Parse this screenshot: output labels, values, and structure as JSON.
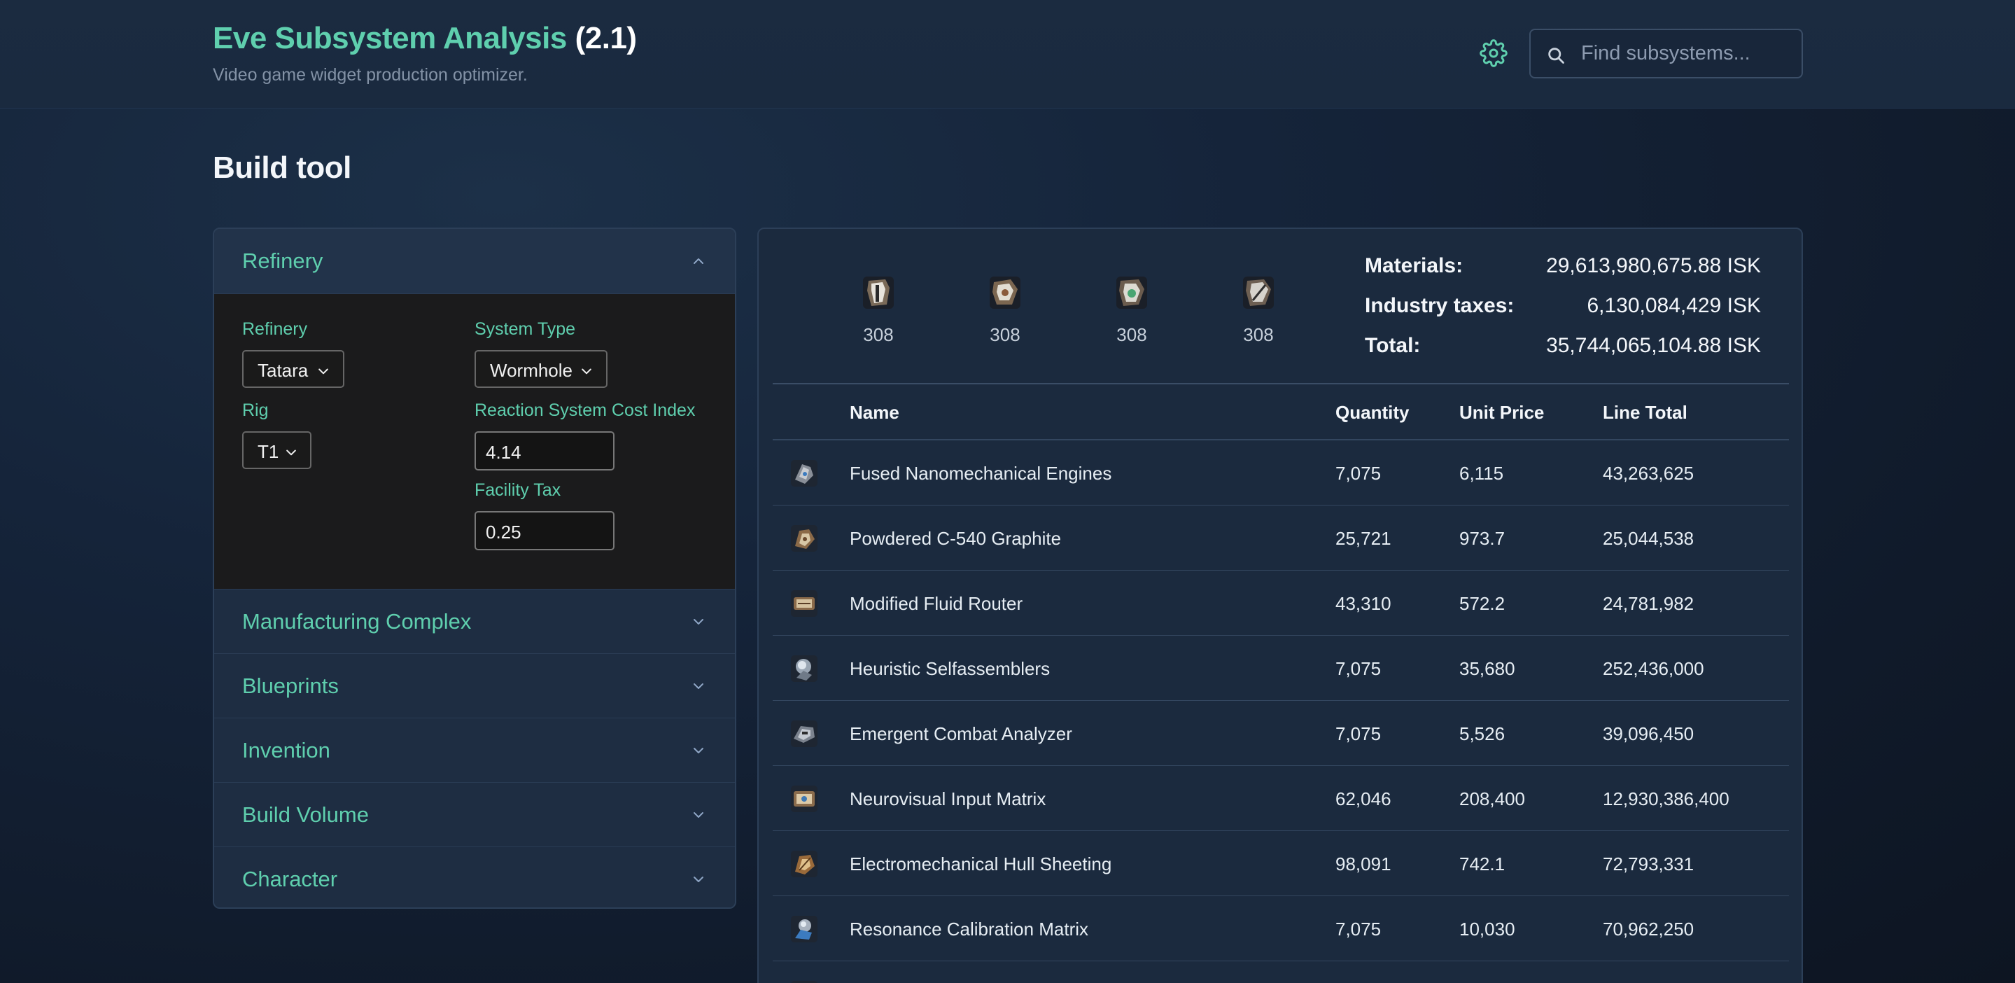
{
  "header": {
    "app_name": "Eve Subsystem Analysis",
    "version": "(2.1)",
    "subtitle": "Video game widget production optimizer.",
    "search_placeholder": "Find subsystems..."
  },
  "page": {
    "title": "Build tool"
  },
  "accordion": {
    "sections": [
      {
        "label": "Refinery",
        "open": true
      },
      {
        "label": "Manufacturing Complex",
        "open": false
      },
      {
        "label": "Blueprints",
        "open": false
      },
      {
        "label": "Invention",
        "open": false
      },
      {
        "label": "Build Volume",
        "open": false
      },
      {
        "label": "Character",
        "open": false
      }
    ],
    "refinery": {
      "refinery_label": "Refinery",
      "refinery_value": "Tatara",
      "system_type_label": "System Type",
      "system_type_value": "Wormhole",
      "rig_label": "Rig",
      "rig_value": "T1",
      "cost_index_label": "Reaction System Cost Index",
      "cost_index_value": "4.14",
      "facility_tax_label": "Facility Tax",
      "facility_tax_value": "0.25"
    }
  },
  "summary": {
    "materials": [
      {
        "icon": "subsystem-core-icon",
        "qty": "308"
      },
      {
        "icon": "subsystem-defensive-icon",
        "qty": "308"
      },
      {
        "icon": "subsystem-offensive-icon",
        "qty": "308"
      },
      {
        "icon": "subsystem-propulsion-icon",
        "qty": "308"
      }
    ],
    "materials_label": "Materials:",
    "materials_value": "29,613,980,675.88 ISK",
    "taxes_label": "Industry taxes:",
    "taxes_value": "6,130,084,429 ISK",
    "total_label": "Total:",
    "total_value": "35,744,065,104.88 ISK"
  },
  "table": {
    "columns": [
      "Name",
      "Quantity",
      "Unit Price",
      "Line Total"
    ],
    "rows": [
      {
        "name": "Fused Nanomechanical Engines",
        "quantity": "7,075",
        "unit_price": "6,115",
        "line_total": "43,263,625",
        "icon": "component-icon"
      },
      {
        "name": "Powdered C-540 Graphite",
        "quantity": "25,721",
        "unit_price": "973.7",
        "line_total": "25,044,538",
        "icon": "component-icon"
      },
      {
        "name": "Modified Fluid Router",
        "quantity": "43,310",
        "unit_price": "572.2",
        "line_total": "24,781,982",
        "icon": "component-icon"
      },
      {
        "name": "Heuristic Selfassemblers",
        "quantity": "7,075",
        "unit_price": "35,680",
        "line_total": "252,436,000",
        "icon": "component-icon"
      },
      {
        "name": "Emergent Combat Analyzer",
        "quantity": "7,075",
        "unit_price": "5,526",
        "line_total": "39,096,450",
        "icon": "component-icon"
      },
      {
        "name": "Neurovisual Input Matrix",
        "quantity": "62,046",
        "unit_price": "208,400",
        "line_total": "12,930,386,400",
        "icon": "component-icon"
      },
      {
        "name": "Electromechanical Hull Sheeting",
        "quantity": "98,091",
        "unit_price": "742.1",
        "line_total": "72,793,331",
        "icon": "component-icon"
      },
      {
        "name": "Resonance Calibration Matrix",
        "quantity": "7,075",
        "unit_price": "10,030",
        "line_total": "70,962,250",
        "icon": "component-icon"
      }
    ]
  },
  "colors": {
    "accent": "#5fcfae",
    "background": "#15243a",
    "panel": "#1b2a3e"
  }
}
